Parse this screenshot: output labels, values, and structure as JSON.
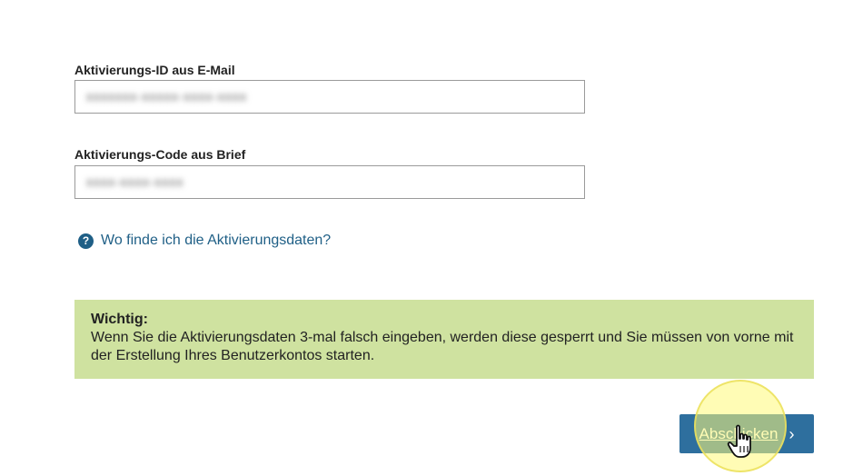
{
  "form": {
    "activation_id": {
      "label": "Aktivierungs-ID aus E-Mail",
      "value": "xxxxxxx-xxxxx-xxxx-xxxx"
    },
    "activation_code": {
      "label": "Aktivierungs-Code aus Brief",
      "value": "xxxx-xxxx-xxxx"
    }
  },
  "help": {
    "icon": "question-circle-icon",
    "link_text": "Wo finde ich die Aktivierungsdaten?"
  },
  "notice": {
    "title": "Wichtig:",
    "body": "Wenn Sie die Aktivierungsdaten 3-mal falsch eingeben, werden diese gesperrt und Sie müssen von vorne mit der Erstellung Ihres Benutzerkontos starten."
  },
  "submit": {
    "label": "Abschicken",
    "chevron": "›"
  },
  "colors": {
    "link": "#1f5f86",
    "notice_bg": "#cfe2a0",
    "button_bg": "#2e6f9e"
  }
}
